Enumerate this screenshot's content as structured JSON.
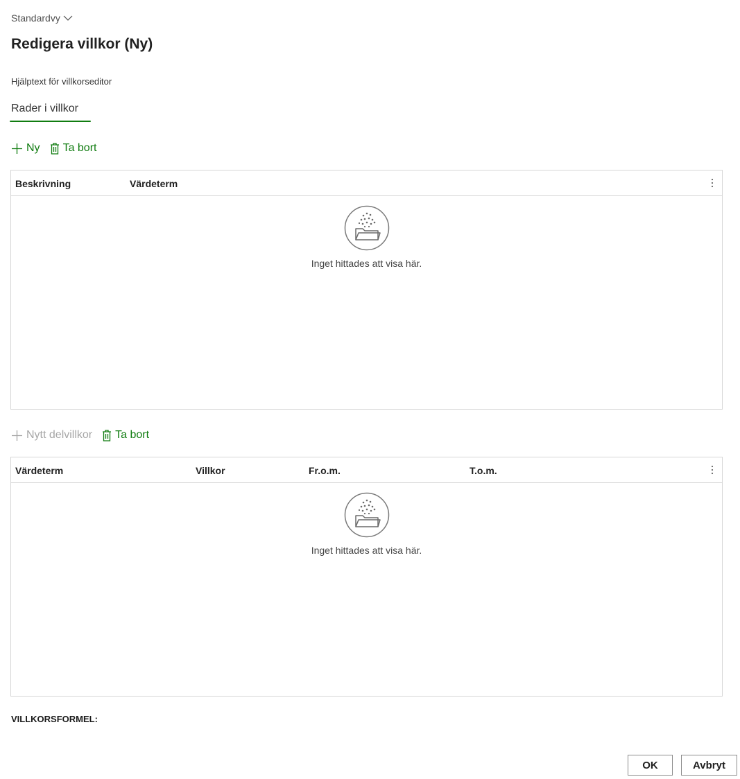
{
  "header": {
    "view_label": "Standardvy",
    "title": "Redigera villkor (Ny)",
    "help_text": "Hjälptext för villkorseditor"
  },
  "tabs": [
    {
      "label": "Rader i villkor",
      "selected": true
    }
  ],
  "colors": {
    "accent": "#107c10",
    "disabled": "#a6a6a6",
    "border": "#d6d6d6"
  },
  "rows_section": {
    "actions": {
      "new_label": "Ny",
      "new_icon": "plus-icon",
      "delete_label": "Ta bort",
      "delete_icon": "trash-icon"
    },
    "columns": [
      "Beskrivning",
      "Värdeterm"
    ],
    "rows": [],
    "empty_text": "Inget hittades att visa här.",
    "empty_icon": "empty-folder-icon"
  },
  "subconditions_section": {
    "actions": {
      "new_label": "Nytt delvillkor",
      "new_icon": "plus-icon",
      "new_enabled": false,
      "delete_label": "Ta bort",
      "delete_icon": "trash-icon"
    },
    "columns": [
      "Värdeterm",
      "Villkor",
      "Fr.o.m.",
      "T.o.m."
    ],
    "rows": [],
    "empty_text": "Inget hittades att visa här.",
    "empty_icon": "empty-folder-icon"
  },
  "formula": {
    "label": "VILLKORSFORMEL:"
  },
  "footer": {
    "ok_label": "OK",
    "cancel_label": "Avbryt"
  }
}
